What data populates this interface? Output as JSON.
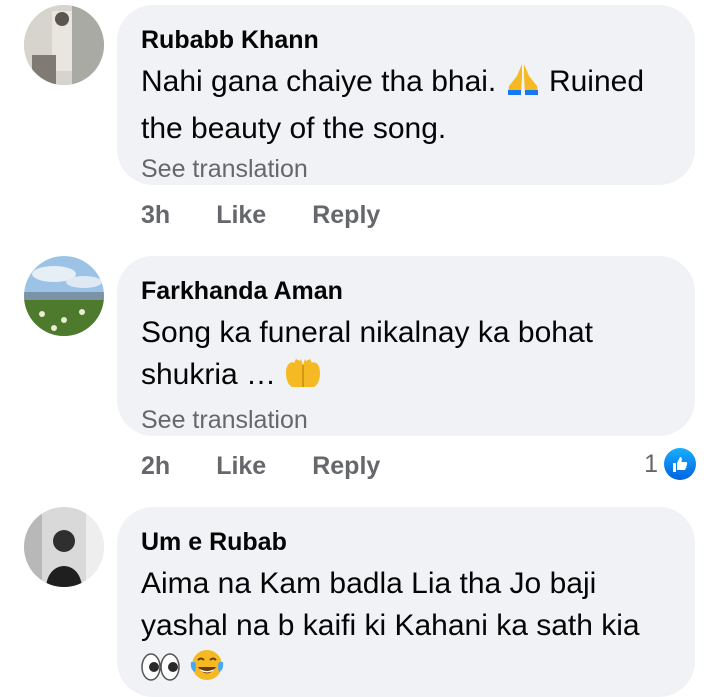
{
  "comments": [
    {
      "author": "Rubabb Khann",
      "text_before_emoji": "Nahi gana chaiye tha bhai.",
      "emoji": "folded-hands",
      "text_after_emoji": " Ruined the beauty of the song.",
      "see_translation": "See translation",
      "time": "3h",
      "like_label": "Like",
      "reply_label": "Reply"
    },
    {
      "author": "Farkhanda Aman",
      "text_before_emoji": "Song ka funeral nikalnay ka bohat shukria … ",
      "emoji": "palms-up-together",
      "see_translation": "See translation",
      "time": "2h",
      "like_label": "Like",
      "reply_label": "Reply",
      "reaction_count": "1",
      "reaction_type": "like-icon"
    },
    {
      "author": "Um e Rubab",
      "text": "Aima na Kam badla Lia tha Jo baji yashal na b kaifi ki Kahani ka sath kia",
      "emoji": [
        "eyes",
        "face-with-tears-of-joy"
      ]
    }
  ],
  "colors": {
    "bubble_bg": "#f0f2f5",
    "meta_gray": "#65676b",
    "like_blue": "#1877f2"
  }
}
